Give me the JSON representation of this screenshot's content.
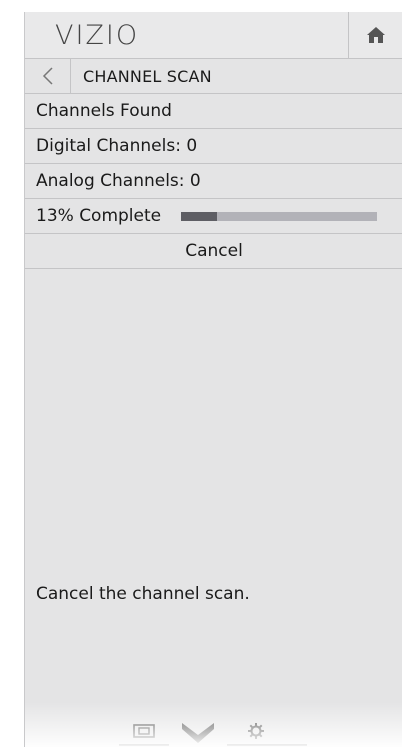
{
  "header": {
    "logo": "VIZIO",
    "home_icon": "home-icon"
  },
  "menu": {
    "title": "CHANNEL SCAN",
    "back_icon": "back-arrow-icon",
    "channels_found_label": "Channels Found",
    "digital_label": "Digital Channels: 0",
    "analog_label": "Analog Channels: 0",
    "progress_label": "13% Complete",
    "progress_value": 0.13,
    "cancel_label": "Cancel"
  },
  "help_text": "Cancel the channel scan.",
  "bottom_bar": {
    "icons": [
      "input-screen-icon",
      "chevron-down-icon",
      "gear-icon"
    ]
  },
  "colors": {
    "panel_bg": "#e4e4e5",
    "progress_fill": "#5e5e64",
    "progress_track": "#b2b2b8"
  }
}
